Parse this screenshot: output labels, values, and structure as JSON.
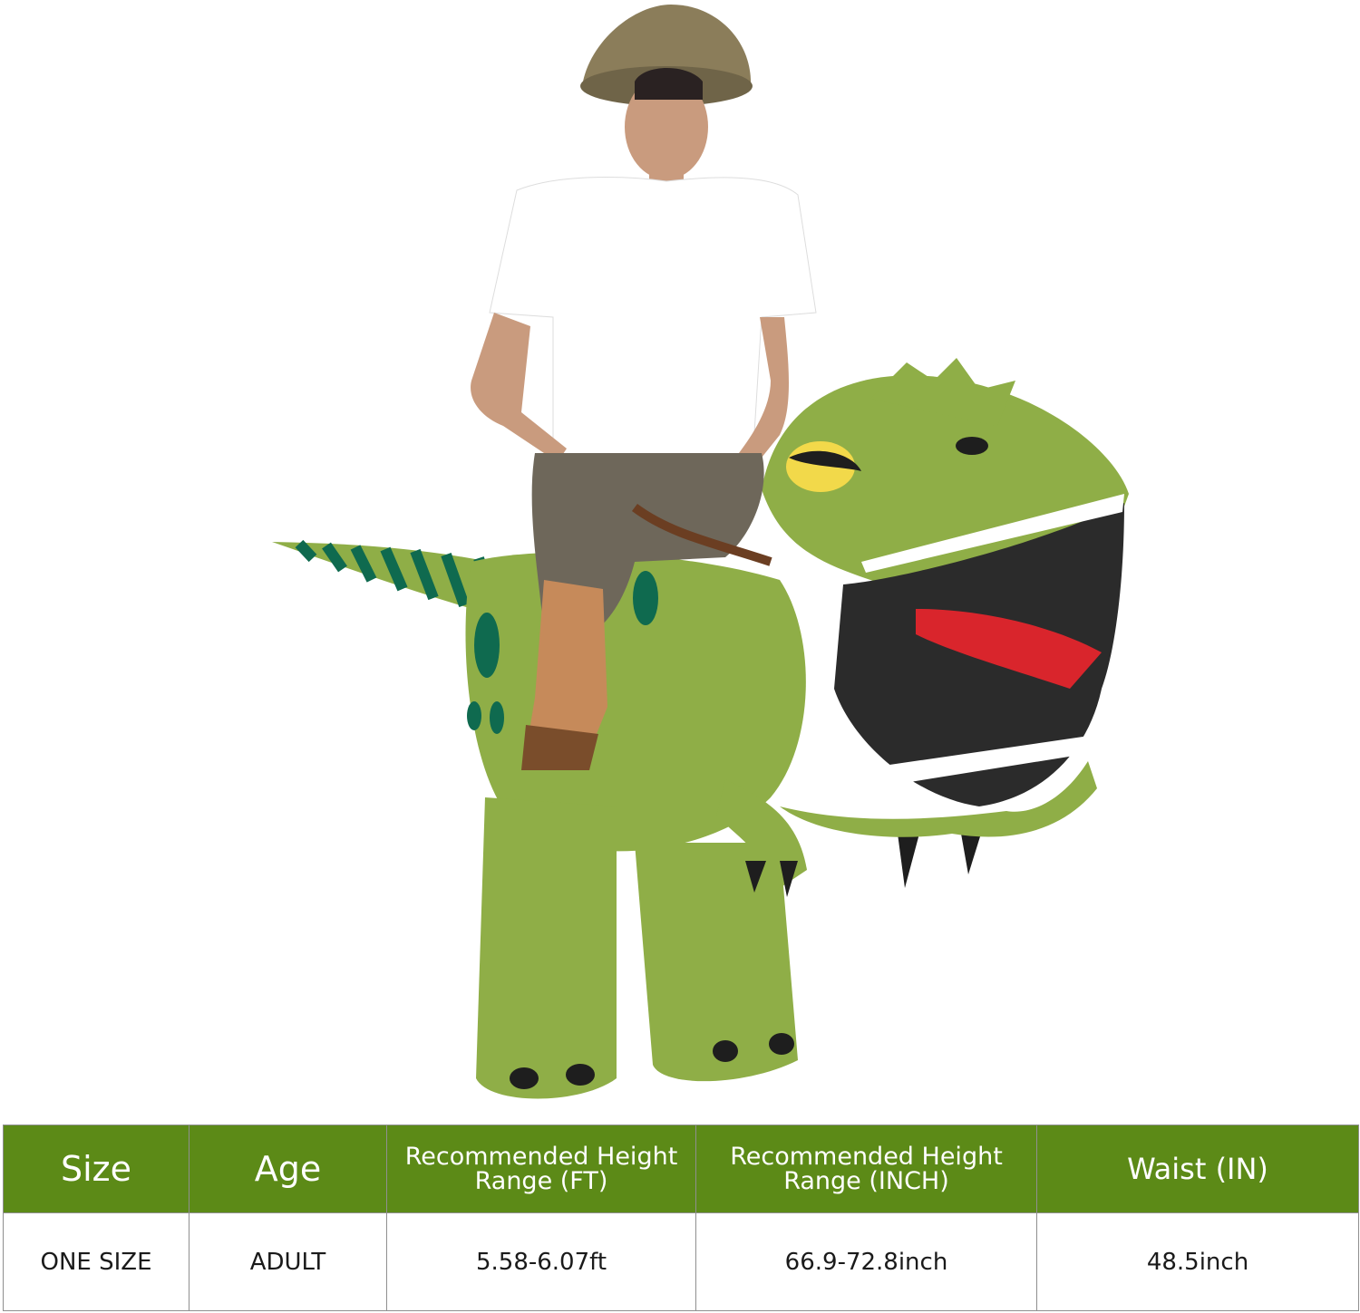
{
  "product": {
    "image_subject": "inflatable-dinosaur-rider-costume",
    "colors": {
      "header_green": "#5c8a17",
      "dino_green": "#8fae47",
      "dino_stripe": "#0f6a4f",
      "tongue_red": "#d9252c",
      "mouth_dark": "#2b2b2b"
    }
  },
  "size_chart": {
    "headers": [
      "Size",
      "Age",
      "Recommended Height Range (FT)",
      "Recommended Height Range (INCH)",
      "Waist (IN)"
    ],
    "row": {
      "size": "ONE SIZE",
      "age": "ADULT",
      "height_ft": "5.58-6.07ft",
      "height_inch": "66.9-72.8inch",
      "waist": "48.5inch"
    }
  }
}
